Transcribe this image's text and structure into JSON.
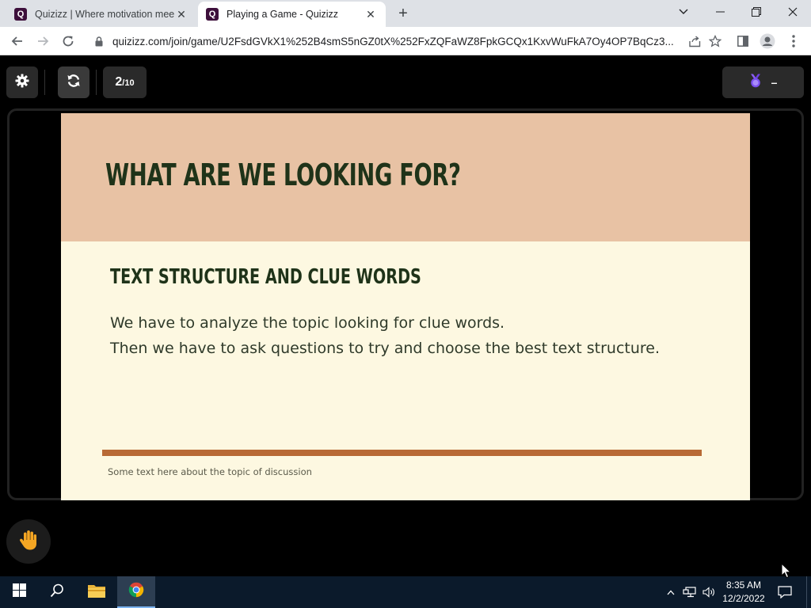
{
  "browser": {
    "tabs": [
      {
        "title": "Quizizz | Where motivation meet",
        "favicon": "Q",
        "active": false
      },
      {
        "title": "Playing a Game - Quizizz",
        "favicon": "Q",
        "active": true
      }
    ],
    "url": "quizizz.com/join/game/U2FsdGVkX1%252B4smS5nGZ0tX%252FxZQFaWZ8FpkGCQx1KxvWuFkA7Oy4OP7BqCz3..."
  },
  "game": {
    "question_current": "2",
    "question_total": "/10",
    "powerup_value": "–"
  },
  "slide": {
    "title": "WHAT ARE WE LOOKING FOR?",
    "subtitle": "TEXT STRUCTURE AND CLUE WORDS",
    "body_line1": "We have to analyze the topic looking for clue words.",
    "body_line2": "Then we have to ask questions to try and choose the best text structure.",
    "footer": "Some text here about the topic of discussion",
    "colors": {
      "header_bg": "#e8c2a4",
      "body_bg": "#fdf8e1",
      "title_text": "#1f3319",
      "rule": "#b86a35"
    }
  },
  "taskbar": {
    "time": "8:35 AM",
    "date": "12/2/2022"
  },
  "icons": [
    "settings-gear-icon",
    "refresh-icon",
    "medal-icon",
    "raise-hand-icon",
    "windows-start-icon",
    "search-icon",
    "file-explorer-icon",
    "chrome-icon"
  ]
}
